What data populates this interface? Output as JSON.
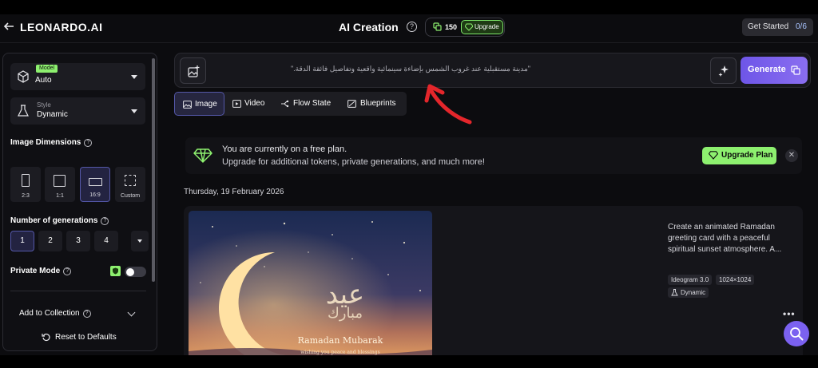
{
  "topbar": {
    "logo": "LEONARDO.AI",
    "title": "AI Creation",
    "tokens": "150",
    "upgrade": "Upgrade",
    "get_started": "Get Started",
    "get_started_count": "0/6"
  },
  "sidebar": {
    "model_badge": "Model",
    "model_value": "Auto",
    "style_label": "Style",
    "style_value": "Dynamic",
    "dimensions_label": "Image Dimensions",
    "dimensions": [
      {
        "label": "2:3",
        "active": false
      },
      {
        "label": "1:1",
        "active": false
      },
      {
        "label": "16:9",
        "active": true
      },
      {
        "label": "Custom",
        "active": false
      }
    ],
    "generations_label": "Number of generations",
    "generations": [
      "1",
      "2",
      "3",
      "4"
    ],
    "generations_selected": "1",
    "private_mode_label": "Private Mode",
    "private_mode_on": false,
    "add_to_collection": "Add to Collection",
    "reset": "Reset to Defaults"
  },
  "prompt": {
    "text": "\"مدينة مستقبلية عند غروب الشمس بإضاءة سينمائية واقعية وتفاصيل فائقة الدقة.\"",
    "generate_label": "Generate"
  },
  "tabs": [
    {
      "label": "Image",
      "icon": "image-icon",
      "active": true
    },
    {
      "label": "Video",
      "icon": "video-icon",
      "active": false
    },
    {
      "label": "Flow State",
      "icon": "flow-icon",
      "active": false
    },
    {
      "label": "Blueprints",
      "icon": "blueprint-icon",
      "active": false
    }
  ],
  "banner": {
    "line1": "You are currently on a free plan.",
    "line2": "Upgrade for additional tokens, private generations, and much more!",
    "button": "Upgrade Plan"
  },
  "feed": {
    "date": "Thursday, 19 February 2026",
    "card": {
      "prompt": "Create an animated Ramadan greeting card with a peaceful spiritual sunset atmosphere. A...",
      "model_chip": "Ideogram 3.0",
      "size_chip": "1024×1024",
      "style_chip": "Dynamic",
      "image_title": "Ramadan Mubarak",
      "image_subtitle": "wishing you peace and blessings"
    }
  },
  "colors": {
    "accent": "#7b61f0",
    "green": "#8df06f",
    "background": "#0c0c0f",
    "annotation_arrow": "#e4262b"
  }
}
